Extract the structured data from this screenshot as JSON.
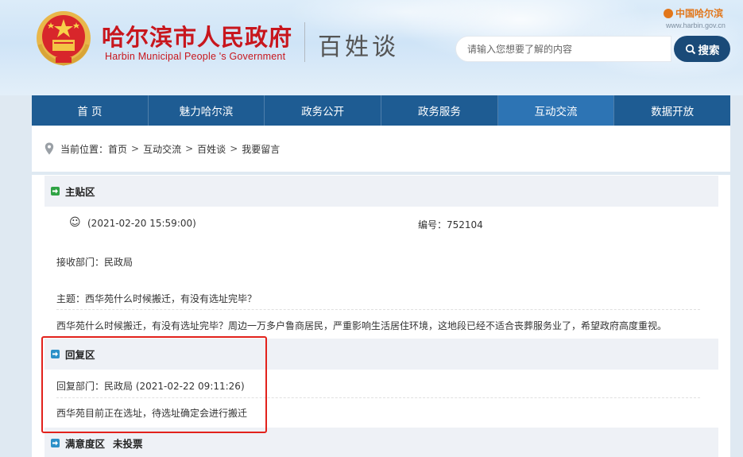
{
  "header": {
    "site_title": "哈尔滨市人民政府",
    "site_subtitle": "Harbin Municipal People 's Government",
    "section_name": "百姓谈",
    "brand_name": "中国哈尔滨",
    "brand_url": "www.harbin.gov.cn",
    "search_placeholder": "请输入您想要了解的内容",
    "search_button": "搜索"
  },
  "nav": {
    "items": [
      {
        "label": "首 页"
      },
      {
        "label": "魅力哈尔滨"
      },
      {
        "label": "政务公开"
      },
      {
        "label": "政务服务"
      },
      {
        "label": "互动交流",
        "active": true
      },
      {
        "label": "数据开放"
      }
    ]
  },
  "breadcrumb": {
    "prefix": "当前位置：",
    "items": [
      "首页",
      "互动交流",
      "百姓谈",
      "我要留言"
    ],
    "separator": ">"
  },
  "post": {
    "section_title": "主贴区",
    "timestamp": "(2021-02-20 15:59:00)",
    "number_label": "编号：752104",
    "department": "接收部门：民政局",
    "subject": "主题：西华苑什么时候搬迁，有没有选址完毕？",
    "body": "西华苑什么时候搬迁，有没有选址完毕？周边一万多户鲁商居民，严重影响生活居住环境，这地段已经不适合丧葬服务业了，希望政府高度重视。"
  },
  "reply": {
    "section_title": "回复区",
    "meta": "回复部门：民政局 (2021-02-22 09:11:26)",
    "body": "西华苑目前正在选址，待选址确定会进行搬迁"
  },
  "satisfaction": {
    "section_title": "满意度区",
    "status": "未投票"
  },
  "colors": {
    "nav_bg": "#1e5c93",
    "nav_active": "#2d74b4",
    "title_red": "#c8161d",
    "search_button": "#1a4a78",
    "highlight_border": "#e2221c"
  }
}
